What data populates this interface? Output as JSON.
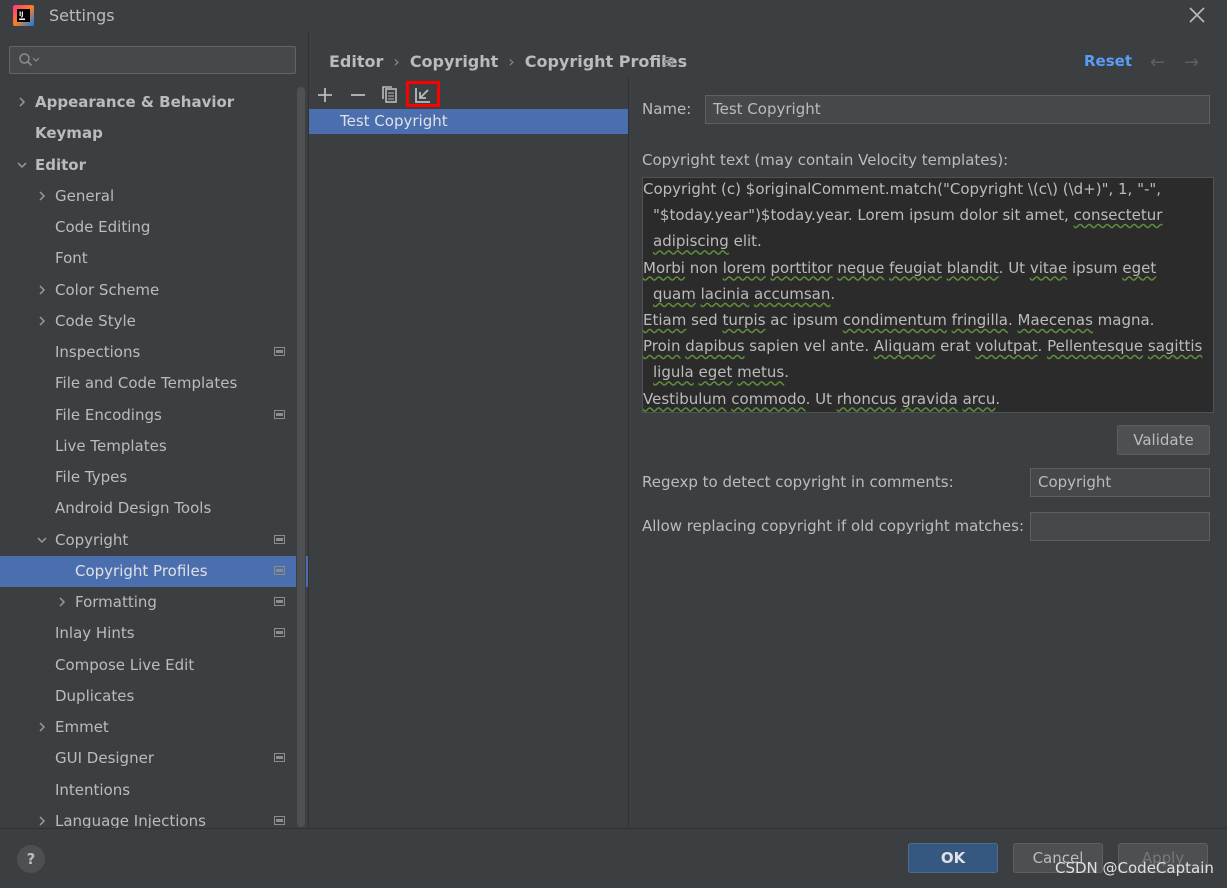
{
  "window": {
    "title": "Settings"
  },
  "search": {
    "placeholder": ""
  },
  "tree": [
    {
      "label": "Appearance & Behavior",
      "level": 0,
      "bold": true,
      "chevron": "right",
      "proj": false
    },
    {
      "label": "Keymap",
      "level": 0,
      "bold": true,
      "chevron": "",
      "proj": false
    },
    {
      "label": "Editor",
      "level": 0,
      "bold": true,
      "chevron": "down",
      "proj": false
    },
    {
      "label": "General",
      "level": 1,
      "bold": false,
      "chevron": "right",
      "proj": false
    },
    {
      "label": "Code Editing",
      "level": 1,
      "bold": false,
      "chevron": "",
      "proj": false
    },
    {
      "label": "Font",
      "level": 1,
      "bold": false,
      "chevron": "",
      "proj": false
    },
    {
      "label": "Color Scheme",
      "level": 1,
      "bold": false,
      "chevron": "right",
      "proj": false
    },
    {
      "label": "Code Style",
      "level": 1,
      "bold": false,
      "chevron": "right",
      "proj": false
    },
    {
      "label": "Inspections",
      "level": 1,
      "bold": false,
      "chevron": "",
      "proj": true
    },
    {
      "label": "File and Code Templates",
      "level": 1,
      "bold": false,
      "chevron": "",
      "proj": false
    },
    {
      "label": "File Encodings",
      "level": 1,
      "bold": false,
      "chevron": "",
      "proj": true
    },
    {
      "label": "Live Templates",
      "level": 1,
      "bold": false,
      "chevron": "",
      "proj": false
    },
    {
      "label": "File Types",
      "level": 1,
      "bold": false,
      "chevron": "",
      "proj": false
    },
    {
      "label": "Android Design Tools",
      "level": 1,
      "bold": false,
      "chevron": "",
      "proj": false
    },
    {
      "label": "Copyright",
      "level": 1,
      "bold": false,
      "chevron": "down",
      "proj": true
    },
    {
      "label": "Copyright Profiles",
      "level": 2,
      "bold": false,
      "chevron": "",
      "proj": true,
      "selected": true
    },
    {
      "label": "Formatting",
      "level": 2,
      "bold": false,
      "chevron": "right",
      "proj": true
    },
    {
      "label": "Inlay Hints",
      "level": 1,
      "bold": false,
      "chevron": "",
      "proj": true
    },
    {
      "label": "Compose Live Edit",
      "level": 1,
      "bold": false,
      "chevron": "",
      "proj": false
    },
    {
      "label": "Duplicates",
      "level": 1,
      "bold": false,
      "chevron": "",
      "proj": false
    },
    {
      "label": "Emmet",
      "level": 1,
      "bold": false,
      "chevron": "right",
      "proj": false
    },
    {
      "label": "GUI Designer",
      "level": 1,
      "bold": false,
      "chevron": "",
      "proj": true
    },
    {
      "label": "Intentions",
      "level": 1,
      "bold": false,
      "chevron": "",
      "proj": false
    },
    {
      "label": "Language Injections",
      "level": 1,
      "bold": false,
      "chevron": "right",
      "proj": true
    }
  ],
  "breadcrumb": {
    "item1": "Editor",
    "item2": "Copyright",
    "item3": "Copyright Profiles",
    "sep": "›"
  },
  "header": {
    "reset": "Reset",
    "back": "←",
    "forward": "→"
  },
  "toolbar": {
    "add": "+",
    "remove": "−"
  },
  "profiles": {
    "selected": "Test Copyright"
  },
  "form": {
    "name_label": "Name:",
    "name_value": "Test Copyright",
    "ct_label": "Copyright text (may contain Velocity templates):",
    "ct_lines": [
      {
        "indent": false,
        "parts": [
          [
            "Copyright (c) $originalComment.match(\"Copyright \\(c\\) (\\d+)\", 1, \"-\",",
            false
          ]
        ]
      },
      {
        "indent": true,
        "parts": [
          [
            "\"$today.year\")$today.year. Lorem ipsum dolor sit amet, ",
            false
          ],
          [
            "consectetur",
            true
          ]
        ]
      },
      {
        "indent": true,
        "parts": [
          [
            "adipiscing",
            true
          ],
          [
            " elit.",
            false
          ]
        ]
      },
      {
        "indent": false,
        "parts": [
          [
            "Morbi",
            true
          ],
          [
            " non ",
            false
          ],
          [
            "lorem",
            true
          ],
          [
            " ",
            false
          ],
          [
            "porttitor",
            true
          ],
          [
            " ",
            false
          ],
          [
            "neque",
            true
          ],
          [
            " ",
            false
          ],
          [
            "feugiat",
            true
          ],
          [
            " ",
            false
          ],
          [
            "blandit",
            true
          ],
          [
            ". Ut ",
            false
          ],
          [
            "vitae",
            true
          ],
          [
            " ipsum ",
            false
          ],
          [
            "eget",
            true
          ]
        ]
      },
      {
        "indent": true,
        "parts": [
          [
            "quam",
            true
          ],
          [
            " ",
            false
          ],
          [
            "lacinia",
            true
          ],
          [
            " ",
            false
          ],
          [
            "accumsan",
            true
          ],
          [
            ".",
            false
          ]
        ]
      },
      {
        "indent": false,
        "parts": [
          [
            "Etiam",
            true
          ],
          [
            " sed ",
            false
          ],
          [
            "turpis",
            true
          ],
          [
            " ac ipsum ",
            false
          ],
          [
            "condimentum",
            true
          ],
          [
            " ",
            false
          ],
          [
            "fringilla",
            true
          ],
          [
            ". ",
            false
          ],
          [
            "Maecenas",
            true
          ],
          [
            " magna.",
            false
          ]
        ]
      },
      {
        "indent": false,
        "parts": [
          [
            "Proin",
            true
          ],
          [
            " ",
            false
          ],
          [
            "dapibus",
            true
          ],
          [
            " sapien vel ante. ",
            false
          ],
          [
            "Aliquam",
            true
          ],
          [
            " erat ",
            false
          ],
          [
            "volutpat",
            true
          ],
          [
            ". ",
            false
          ],
          [
            "Pellentesque",
            true
          ],
          [
            " ",
            false
          ],
          [
            "sagittis",
            true
          ]
        ]
      },
      {
        "indent": true,
        "parts": [
          [
            "ligula",
            true
          ],
          [
            " ",
            false
          ],
          [
            "eget",
            true
          ],
          [
            " ",
            false
          ],
          [
            "metus",
            true
          ],
          [
            ".",
            false
          ]
        ]
      },
      {
        "indent": false,
        "parts": [
          [
            "Vestibulum",
            true
          ],
          [
            " ",
            false
          ],
          [
            "commodo",
            true
          ],
          [
            ". Ut ",
            false
          ],
          [
            "rhoncus",
            true
          ],
          [
            " ",
            false
          ],
          [
            "gravida",
            true
          ],
          [
            " ",
            false
          ],
          [
            "arcu",
            true
          ],
          [
            ".",
            false
          ]
        ]
      }
    ],
    "validate": "Validate",
    "regexp_label": "Regexp to detect copyright in comments:",
    "regexp_value": "Copyright",
    "allow_label": "Allow replacing copyright if old copyright matches:",
    "allow_value": ""
  },
  "footer": {
    "help": "?",
    "ok": "OK",
    "cancel": "Cancel",
    "apply": "Apply"
  },
  "watermark": "CSDN @CodeCaptain",
  "colors": {
    "accent": "#4b6eaf",
    "link": "#589df6",
    "highlight": "#ff0000"
  }
}
